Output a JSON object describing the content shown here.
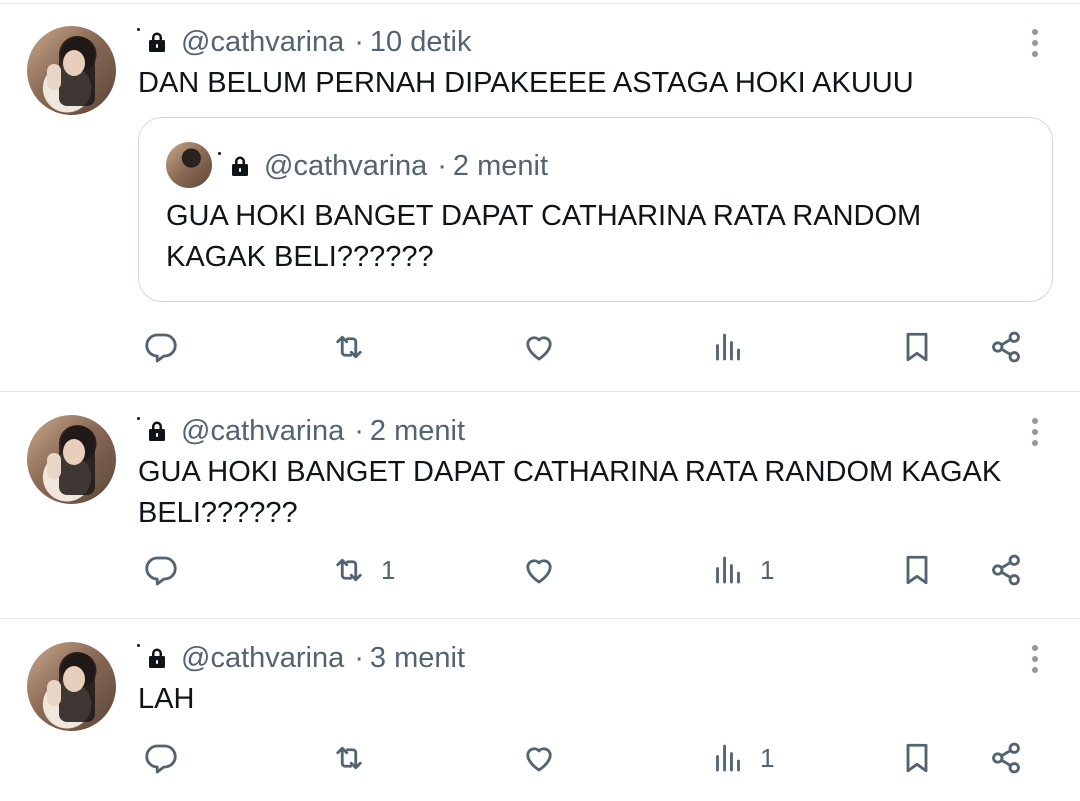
{
  "tweets": [
    {
      "handle": "@cathvarina",
      "separator": "·",
      "time": "10 detik",
      "text": "DAN BELUM PERNAH DIPAKEEEE ASTAGA HOKI AKUUU",
      "quote": {
        "handle": "@cathvarina",
        "separator": "·",
        "time": "2 menit",
        "text": "GUA HOKI BANGET DAPAT CATHARINA RATA RANDOM KAGAK BELI??????"
      },
      "actions": {
        "replies": "",
        "reposts": "",
        "likes": "",
        "views": ""
      }
    },
    {
      "handle": "@cathvarina",
      "separator": "·",
      "time": "2 menit",
      "text": "GUA HOKI BANGET DAPAT CATHARINA RATA RANDOM KAGAK BELI??????",
      "actions": {
        "replies": "",
        "reposts": "1",
        "likes": "",
        "views": "1"
      }
    },
    {
      "handle": "@cathvarina",
      "separator": "·",
      "time": "3 menit",
      "text": "LAH",
      "actions": {
        "replies": "",
        "reposts": "",
        "likes": "",
        "views": "1"
      }
    }
  ],
  "icons": {
    "lock": "lock-icon",
    "more": "more-vertical-icon",
    "reply": "reply-icon",
    "repost": "repost-icon",
    "like": "heart-icon",
    "views": "views-icon",
    "bookmark": "bookmark-icon",
    "share": "share-icon"
  },
  "colors": {
    "text": "#0f1419",
    "muted": "#536471",
    "divider": "#dfe3e6",
    "quote_border": "#cfd9de"
  }
}
